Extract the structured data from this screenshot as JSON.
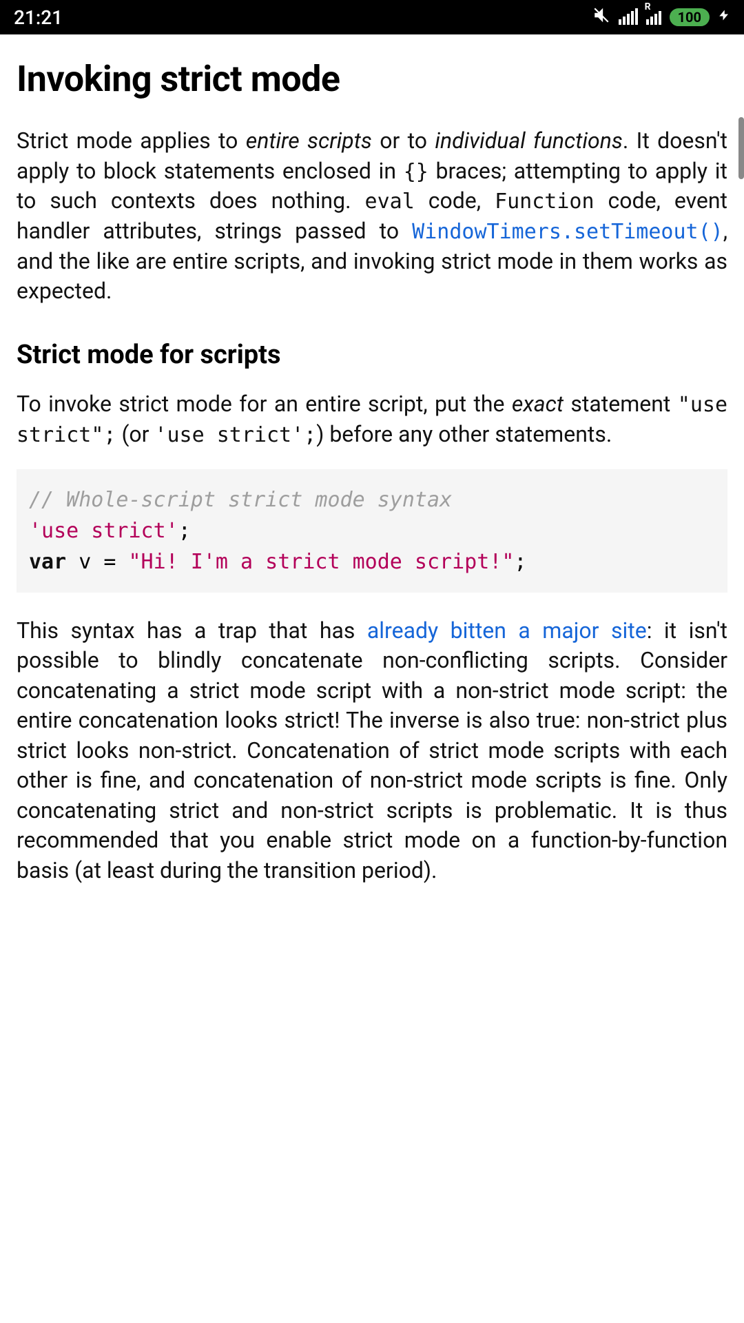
{
  "status": {
    "time": "21:21",
    "battery": "100",
    "r_badge": "R"
  },
  "heading": "Invoking strict mode",
  "p1": {
    "t1": "Strict mode applies to ",
    "em1": "entire scripts",
    "t2": " or to ",
    "em2": "individual functions",
    "t3": ". It doesn't apply to block statements enclosed in ",
    "code1": "{}",
    "t4": " braces; attempting to apply it to such contexts does nothing. ",
    "code2": "eval",
    "t5": " code, ",
    "code3": "Function",
    "t6": " code, event handler attributes, strings passed to ",
    "link1": "WindowTimers.setTimeout()",
    "t7": ", and the like are entire scripts, and invoking strict mode in them works as expected."
  },
  "sub1": "Strict mode for scripts",
  "p2": {
    "t1": "To invoke strict mode for an entire script, put the ",
    "em1": "exact",
    "t2": " statement ",
    "code1": "\"use strict\";",
    "t3": " (or ",
    "code2": "'use strict';",
    "t4": ") before any other statements."
  },
  "code_block": {
    "comment": "// Whole-script strict mode syntax",
    "s1": "'use strict'",
    "semi1": ";",
    "kw": "var",
    "var": " v = ",
    "s2": "\"Hi! I'm a strict mode script!\"",
    "semi2": ";"
  },
  "p3": {
    "t1": "This syntax has a trap that has ",
    "link1": "already bitten a major site",
    "t2": ": it isn't possible to blindly concatenate non-conflicting scripts. Consider concatenating a strict mode script with a non-strict mode script: the entire concatenation looks strict! The inverse is also true: non-strict plus strict looks non-strict. Concatenation of strict mode scripts with each other is fine, and concatenation of non-strict mode scripts is fine. Only concatenating strict and non-strict scripts is problematic. It is thus recommended that you enable strict mode on a function-by-function basis (at least during the transition period)."
  }
}
